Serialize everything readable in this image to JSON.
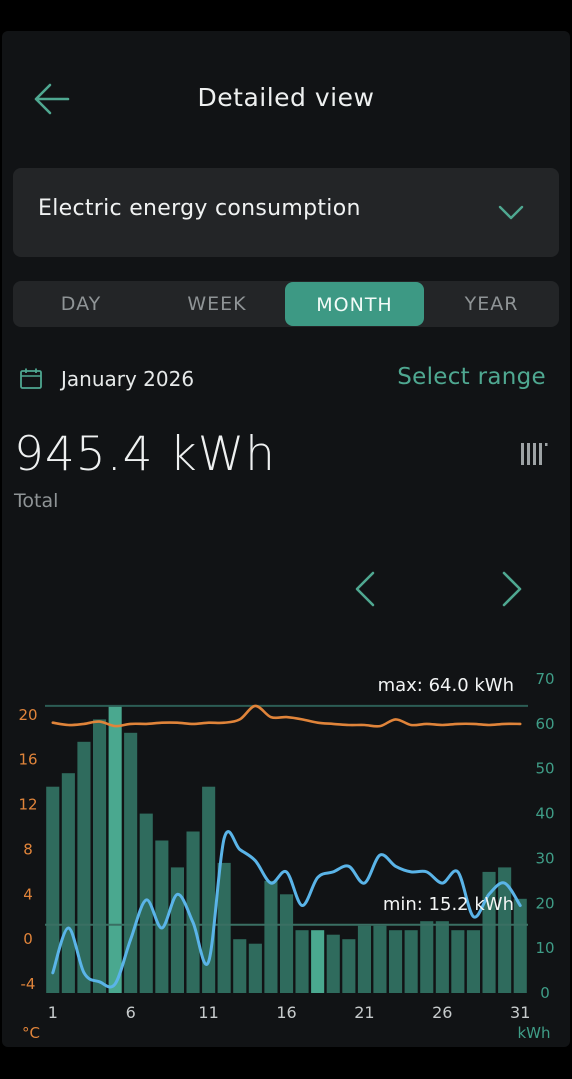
{
  "header": {
    "title": "Detailed view",
    "back_icon": "arrow-left-icon"
  },
  "selector": {
    "value": "Electric energy consumption",
    "chevron_icon": "chevron-down-icon"
  },
  "tabs": [
    {
      "label": "DAY",
      "active": false
    },
    {
      "label": "WEEK",
      "active": false
    },
    {
      "label": "MONTH",
      "active": true
    },
    {
      "label": "YEAR",
      "active": false
    }
  ],
  "period": {
    "icon": "calendar-icon",
    "label": "January 2026",
    "select_range": "Select range"
  },
  "summary": {
    "total_value": "945.4 kWh",
    "total_label": "Total",
    "chart_toggle_icon": "bar-chart-icon"
  },
  "navigation": {
    "prev_icon": "chevron-left-icon",
    "next_icon": "chevron-right-icon"
  },
  "colors": {
    "accent": "#3d9984",
    "bar": "#2f6b5d",
    "bar_highlight": "#4aa88f",
    "temp_outdoor": "#5ab4e8",
    "temp_indoor": "#e0843a",
    "background": "#111315"
  },
  "chart_data": {
    "type": "bar",
    "x": [
      1,
      2,
      3,
      4,
      5,
      6,
      7,
      8,
      9,
      10,
      11,
      12,
      13,
      14,
      15,
      16,
      17,
      18,
      19,
      20,
      21,
      22,
      23,
      24,
      25,
      26,
      27,
      28,
      29,
      30,
      31
    ],
    "x_tick_labels": [
      "1",
      "6",
      "11",
      "16",
      "21",
      "26",
      "31"
    ],
    "x_unit_left": "°C",
    "x_unit_right": "kWh",
    "series": [
      {
        "axis": "right",
        "values": [
          46,
          49,
          56,
          61,
          64,
          58,
          40,
          34,
          28,
          36,
          46,
          29,
          12,
          11,
          25,
          22,
          14,
          14,
          13,
          12,
          15,
          15,
          14,
          14,
          16,
          16,
          14,
          14,
          27,
          28,
          21
        ],
        "highlight_index": [
          4,
          17
        ]
      },
      {
        "axis": "left",
        "values": [
          -3,
          1,
          -3,
          -3.8,
          -4,
          0,
          3.5,
          1,
          4,
          1.5,
          -2,
          9,
          8,
          7,
          5,
          6,
          3,
          5.5,
          6,
          6.5,
          5,
          7.5,
          6.5,
          6,
          6,
          5,
          6,
          2,
          4,
          5,
          3
        ]
      },
      {
        "axis": "left",
        "values": [
          19.3,
          19.1,
          19.2,
          19.4,
          19.0,
          19.2,
          19.2,
          19.3,
          19.3,
          19.2,
          19.3,
          19.3,
          19.6,
          20.8,
          19.8,
          19.8,
          19.6,
          19.3,
          19.2,
          19.1,
          19.1,
          19.0,
          19.6,
          19.1,
          19.2,
          19.1,
          19.2,
          19.2,
          19.1,
          19.2,
          19.2
        ]
      }
    ],
    "y_left": {
      "ticks": [
        20,
        16,
        12,
        8,
        4,
        0,
        -4
      ],
      "range": [
        -4.8,
        23.2
      ]
    },
    "y_right": {
      "ticks": [
        70,
        60,
        50,
        40,
        30,
        20,
        10,
        0
      ],
      "range": [
        0,
        70
      ]
    },
    "reference_lines": [
      {
        "label": "max: 64.0 kWh",
        "value": 64.0
      },
      {
        "label": "min: 15.2 kWh",
        "value": 15.2
      }
    ],
    "grid": false,
    "legend": "none"
  }
}
